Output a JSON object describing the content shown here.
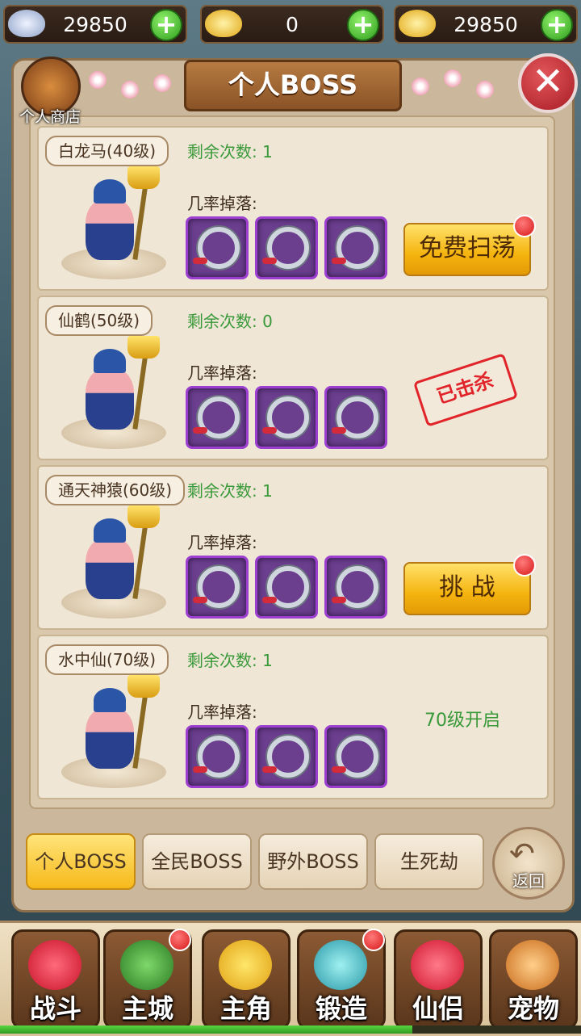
{
  "currency": [
    {
      "name": "silver",
      "amount": "29850",
      "icon": "silver-ingot-icon"
    },
    {
      "name": "gold",
      "amount": "0",
      "icon": "gold-ingot-icon"
    },
    {
      "name": "bound-gold",
      "amount": "29850",
      "icon": "gold-ingot-icon"
    }
  ],
  "header": {
    "title": "个人BOSS",
    "shop_label": "个人商店",
    "close_icon": "close-icon"
  },
  "bosses": [
    {
      "name": "白龙马(40级)",
      "remaining_label": "剩余次数:",
      "remaining": "1",
      "drop_label": "几率掉落:",
      "action": "免费扫荡",
      "state": "button"
    },
    {
      "name": "仙鹤(50级)",
      "remaining_label": "剩余次数:",
      "remaining": "0",
      "drop_label": "几率掉落:",
      "action": "已击杀",
      "state": "killed"
    },
    {
      "name": "通天神猿(60级)",
      "remaining_label": "剩余次数:",
      "remaining": "1",
      "drop_label": "几率掉落:",
      "action": "挑 战",
      "state": "button"
    },
    {
      "name": "水中仙(70级)",
      "remaining_label": "剩余次数:",
      "remaining": "1",
      "drop_label": "几率掉落:",
      "action": "70级开启",
      "state": "locked"
    }
  ],
  "tabs": [
    "个人BOSS",
    "全民BOSS",
    "野外BOSS",
    "生死劫"
  ],
  "back_label": "返回",
  "nav": [
    "战斗",
    "主城",
    "主角",
    "锻造",
    "仙侣",
    "宠物"
  ],
  "colors": {
    "accent": "#f5b40e",
    "remaining_text": "#3a9a3a",
    "killed_stamp": "#e0242a"
  },
  "exp_progress": 0.71
}
